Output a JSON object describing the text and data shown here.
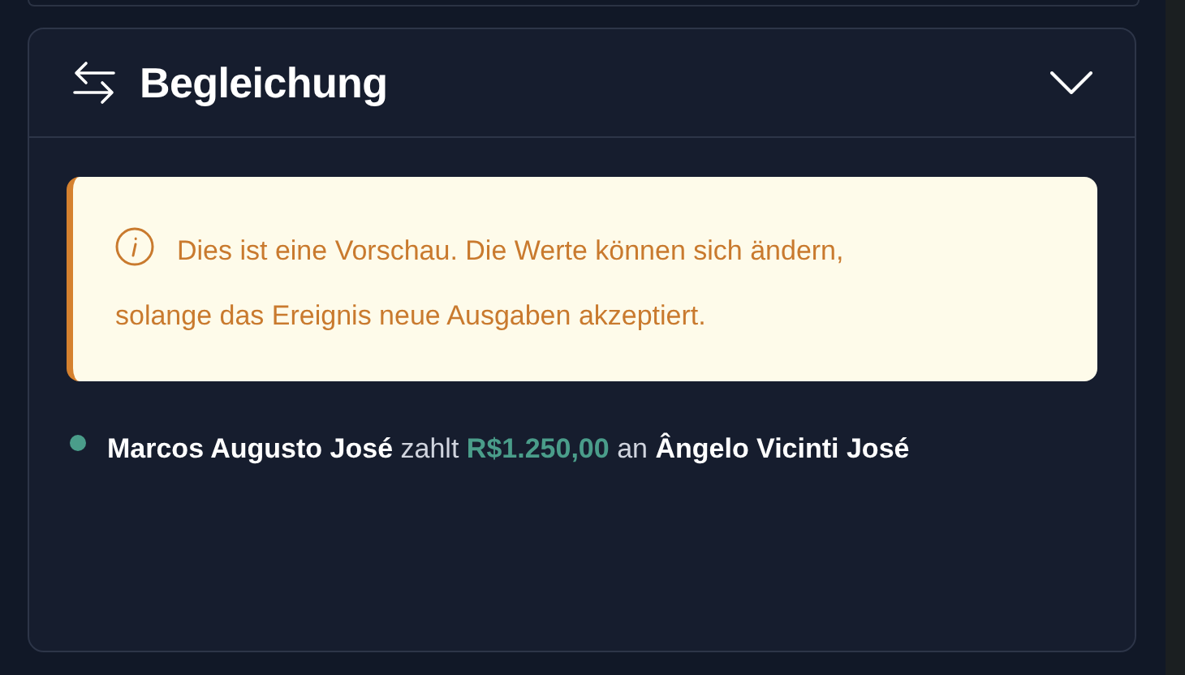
{
  "section": {
    "title": "Begleichung",
    "expanded": true
  },
  "notice": {
    "text": "Dies ist eine Vorschau. Die Werte können sich ändern, solange das Ereignis neue Ausgaben akzeptiert."
  },
  "settlements": [
    {
      "payer": "Marcos Augusto José",
      "verb": "zahlt",
      "amount": "R$1.250,00",
      "preposition": "an",
      "payee": "Ângelo Vicinti José",
      "color": "#4a9d8a"
    }
  ]
}
